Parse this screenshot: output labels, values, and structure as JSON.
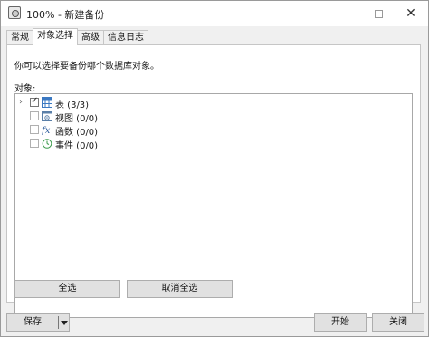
{
  "window": {
    "title": "100% - 新建备份",
    "min_icon": "minimize-icon",
    "max_icon": "maximize-icon",
    "close_glyph": "✕"
  },
  "tabs": [
    {
      "label": "常规",
      "active": false
    },
    {
      "label": "对象选择",
      "active": true
    },
    {
      "label": "高级",
      "active": false
    },
    {
      "label": "信息日志",
      "active": false
    }
  ],
  "panel": {
    "instruction": "你可以选择要备份哪个数据库对象。",
    "objects_label": "对象:"
  },
  "tree": {
    "items": [
      {
        "label": "表 (3/3)",
        "checked": true,
        "expandable": true,
        "icon": "table-icon"
      },
      {
        "label": "视图 (0/0)",
        "checked": false,
        "expandable": false,
        "icon": "view-icon"
      },
      {
        "label": "函数 (0/0)",
        "checked": false,
        "expandable": false,
        "icon": "function-icon"
      },
      {
        "label": "事件 (0/0)",
        "checked": false,
        "expandable": false,
        "icon": "event-clock-icon"
      }
    ]
  },
  "buttons": {
    "select_all": "全选",
    "deselect_all": "取消全选",
    "save": "保存",
    "start": "开始",
    "close": "关闭"
  }
}
